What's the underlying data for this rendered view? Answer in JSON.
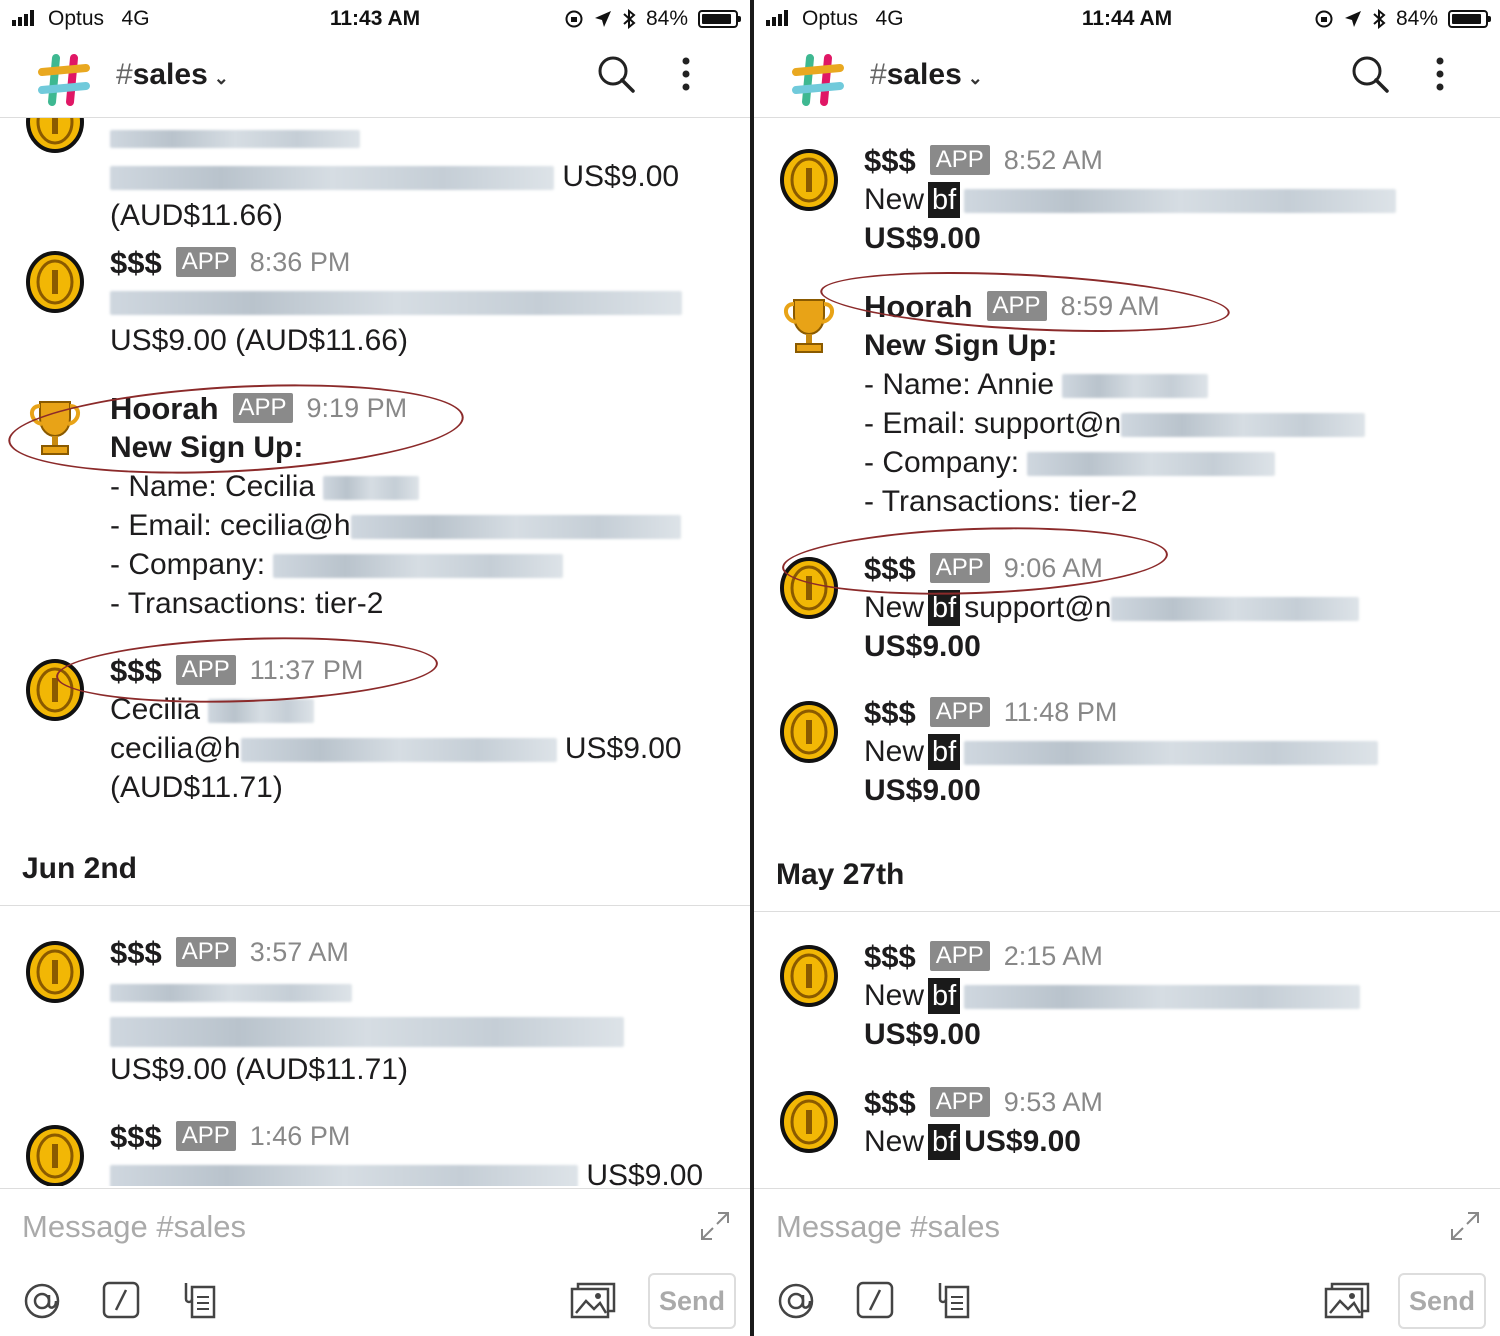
{
  "colors": {
    "circle": "#8b2a2a",
    "app_tag": "#8a8a8a",
    "coin": "#f2b705",
    "timestamp": "#888888"
  },
  "left": {
    "status": {
      "carrier": "Optus",
      "network": "4G",
      "time": "11:43 AM",
      "battery": "84%"
    },
    "header": {
      "channel": "sales",
      "hash": "#",
      "caret": "⌄"
    },
    "feed": {
      "top_amount": "US$9.00",
      "top_aud": "(AUD$11.66)",
      "m1": {
        "name": "$$$",
        "tag": "APP",
        "time": "8:36 PM",
        "line2": "US$9.00 (AUD$11.66)"
      },
      "m2": {
        "name": "Hoorah",
        "tag": "APP",
        "time": "9:19 PM",
        "title": "New Sign Up:",
        "l1": "- Name: Cecilia",
        "l2": "- Email: cecilia@h",
        "l3": "- Company:",
        "l4": "- Transactions: tier-2"
      },
      "m3": {
        "name": "$$$",
        "tag": "APP",
        "time": "11:37 PM",
        "l1": "Cecilia",
        "l2a": "cecilia@h",
        "l2b": "US$9.00",
        "l3": "(AUD$11.71)"
      },
      "date": "Jun 2nd",
      "m4": {
        "name": "$$$",
        "tag": "APP",
        "time": "3:57 AM",
        "l3": "US$9.00 (AUD$11.71)"
      },
      "m5": {
        "name": "$$$",
        "tag": "APP",
        "time": "1:46 PM",
        "amount": "US$9.00"
      }
    },
    "composer": {
      "placeholder": "Message #sales",
      "send": "Send"
    }
  },
  "right": {
    "status": {
      "carrier": "Optus",
      "network": "4G",
      "time": "11:44 AM",
      "battery": "84%"
    },
    "header": {
      "channel": "sales",
      "hash": "#",
      "caret": "⌄"
    },
    "feed": {
      "m1": {
        "name": "$$$",
        "tag": "APP",
        "time": "8:52 AM",
        "new": "New",
        "bf": "bf",
        "amount": "US$9.00"
      },
      "m2": {
        "name": "Hoorah",
        "tag": "APP",
        "time": "8:59 AM",
        "title": "New Sign Up:",
        "l1": "- Name: Annie",
        "l2": "- Email: support@n",
        "l3": "- Company:",
        "l4": "- Transactions: tier-2"
      },
      "m3": {
        "name": "$$$",
        "tag": "APP",
        "time": "9:06 AM",
        "new": "New",
        "bf": "bf",
        "email": "support@n",
        "amount": "US$9.00"
      },
      "m4": {
        "name": "$$$",
        "tag": "APP",
        "time": "11:48 PM",
        "new": "New",
        "bf": "bf",
        "amount": "US$9.00"
      },
      "date": "May 27th",
      "m5": {
        "name": "$$$",
        "tag": "APP",
        "time": "2:15 AM",
        "new": "New",
        "bf": "bf",
        "amount": "US$9.00"
      },
      "m6": {
        "name": "$$$",
        "tag": "APP",
        "time": "9:53 AM",
        "new": "New",
        "bf": "bf",
        "amount": "US$9.00"
      }
    },
    "composer": {
      "placeholder": "Message #sales",
      "send": "Send"
    }
  }
}
